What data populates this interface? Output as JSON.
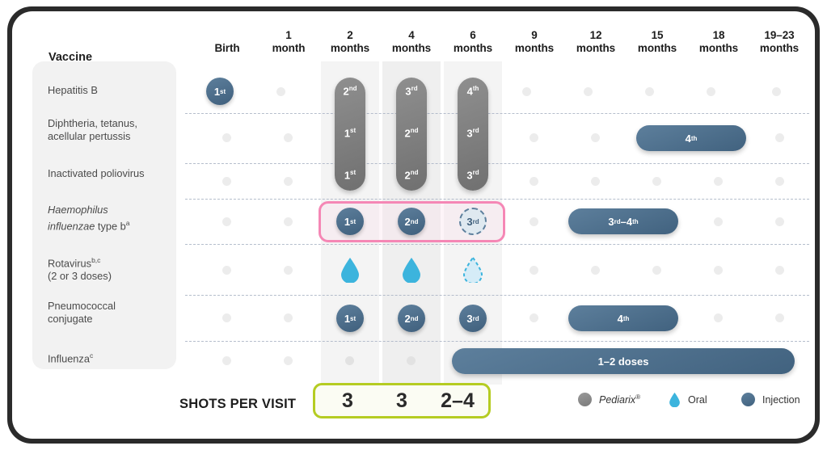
{
  "header": {
    "vaccine_label": "Vaccine",
    "columns": [
      {
        "num": "",
        "unit": "Birth"
      },
      {
        "num": "1",
        "unit": "month"
      },
      {
        "num": "2",
        "unit": "months"
      },
      {
        "num": "4",
        "unit": "months"
      },
      {
        "num": "6",
        "unit": "months"
      },
      {
        "num": "9",
        "unit": "months"
      },
      {
        "num": "12",
        "unit": "months"
      },
      {
        "num": "15",
        "unit": "months"
      },
      {
        "num": "18",
        "unit": "months"
      },
      {
        "num": "19–23",
        "unit": "months"
      }
    ]
  },
  "rows": [
    {
      "label": "Hepatitis B"
    },
    {
      "label": "Diphtheria, tetanus,\nacellular pertussis"
    },
    {
      "label": "Inactivated poliovirus"
    },
    {
      "label": "Haemophilus influenzae type b",
      "sup": "a"
    },
    {
      "label": "Rotavirus",
      "sup": "b,c",
      "sub": "(2 or 3 doses)"
    },
    {
      "label": "Pneumococcal\nconjugate"
    },
    {
      "label": "Influenza",
      "sup": "c"
    }
  ],
  "doses": {
    "hepb_birth": {
      "n": "1",
      "o": "st"
    },
    "pediarix_2mo": [
      {
        "n": "2",
        "o": "nd"
      },
      {
        "n": "1",
        "o": "st"
      },
      {
        "n": "1",
        "o": "st"
      }
    ],
    "pediarix_4mo": [
      {
        "n": "3",
        "o": "rd"
      },
      {
        "n": "2",
        "o": "nd"
      },
      {
        "n": "2",
        "o": "nd"
      }
    ],
    "pediarix_6mo": [
      {
        "n": "4",
        "o": "th"
      },
      {
        "n": "3",
        "o": "rd"
      },
      {
        "n": "3",
        "o": "rd"
      }
    ],
    "dtap_4th": {
      "n": "4",
      "o": "th"
    },
    "hib": [
      {
        "n": "1",
        "o": "st"
      },
      {
        "n": "2",
        "o": "nd"
      },
      {
        "n": "3",
        "o": "rd"
      }
    ],
    "hib_later": {
      "n1": "3",
      "o1": "rd",
      "dash": "–",
      "n2": "4",
      "o2": "th"
    },
    "pcv": [
      {
        "n": "1",
        "o": "st"
      },
      {
        "n": "2",
        "o": "nd"
      },
      {
        "n": "3",
        "o": "rd"
      }
    ],
    "pcv_4th": {
      "n": "4",
      "o": "th"
    },
    "influenza": "1–2 doses"
  },
  "shots_per_visit": {
    "title": "SHOTS PER VISIT",
    "values": [
      "3",
      "3",
      "2–4"
    ]
  },
  "legend": [
    {
      "icon": "gray-circle",
      "label": "Pediarix",
      "sup": "®",
      "italic": true
    },
    {
      "icon": "water-drop",
      "label": "Oral",
      "italic": false
    },
    {
      "icon": "blue-circle",
      "label": "Injection",
      "italic": false
    }
  ],
  "colors": {
    "injection": "#4d6e8a",
    "pediarix": "#7f7f7f",
    "oral": "#45b6dd",
    "highlight_pink": "#f587b5",
    "shots_border": "#b5cc22"
  }
}
